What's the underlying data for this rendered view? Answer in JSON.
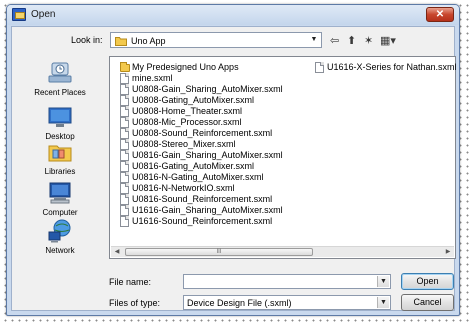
{
  "window": {
    "title": "Open",
    "close_glyph": "✕"
  },
  "toolbar": {
    "look_in_label": "Look in:",
    "look_in_value": "Uno App",
    "back_glyph": "⇦",
    "up_glyph": "⬆",
    "new_folder_glyph": "✶",
    "views_glyph": "▦▾"
  },
  "places": [
    {
      "label": "Recent Places",
      "icon": "recent-places-icon"
    },
    {
      "label": "Desktop",
      "icon": "desktop-icon"
    },
    {
      "label": "Libraries",
      "icon": "libraries-icon"
    },
    {
      "label": "Computer",
      "icon": "computer-icon"
    },
    {
      "label": "Network",
      "icon": "network-icon"
    }
  ],
  "files": {
    "column1": [
      {
        "name": "My Predesigned Uno Apps",
        "type": "folder"
      },
      {
        "name": "mine.sxml",
        "type": "file"
      },
      {
        "name": "U0808-Gain_Sharing_AutoMixer.sxml",
        "type": "file"
      },
      {
        "name": "U0808-Gating_AutoMixer.sxml",
        "type": "file"
      },
      {
        "name": "U0808-Home_Theater.sxml",
        "type": "file"
      },
      {
        "name": "U0808-Mic_Processor.sxml",
        "type": "file"
      },
      {
        "name": "U0808-Sound_Reinforcement.sxml",
        "type": "file"
      },
      {
        "name": "U0808-Stereo_Mixer.sxml",
        "type": "file"
      },
      {
        "name": "U0816-Gain_Sharing_AutoMixer.sxml",
        "type": "file"
      },
      {
        "name": "U0816-Gating_AutoMixer.sxml",
        "type": "file"
      },
      {
        "name": "U0816-N-Gating_AutoMixer.sxml",
        "type": "file"
      },
      {
        "name": "U0816-N-NetworkIO.sxml",
        "type": "file"
      },
      {
        "name": "U0816-Sound_Reinforcement.sxml",
        "type": "file"
      },
      {
        "name": "U1616-Gain_Sharing_AutoMixer.sxml",
        "type": "file"
      },
      {
        "name": "U1616-Sound_Reinforcement.sxml",
        "type": "file"
      }
    ],
    "column2": [
      {
        "name": "U1616-X-Series for Nathan.sxml",
        "type": "file"
      }
    ]
  },
  "scrollbar": {
    "left_glyph": "◀",
    "right_glyph": "▶",
    "thumb_grip": "III"
  },
  "filename": {
    "label": "File name:",
    "value": ""
  },
  "filetype": {
    "label": "Files of type:",
    "value": "Device Design File (.sxml)"
  },
  "buttons": {
    "open": "Open",
    "cancel": "Cancel"
  },
  "dropdown_glyph": "▼",
  "colors": {
    "frame": "#c9d9ee",
    "close": "#c8462d",
    "folder": "#f3c94d"
  }
}
